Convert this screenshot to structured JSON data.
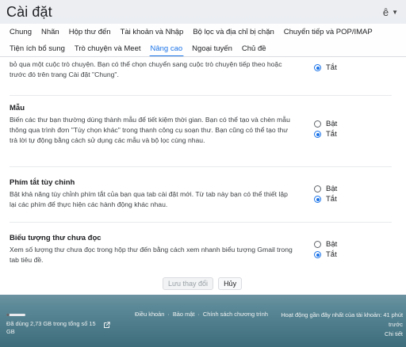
{
  "header": {
    "title": "Cài đặt",
    "lang": "ê"
  },
  "tabs": {
    "row1": [
      "Chung",
      "Nhãn",
      "Hộp thư đến",
      "Tài khoản và Nhập",
      "Bộ lọc và địa chỉ bị chặn",
      "Chuyển tiếp và POP/IMAP"
    ],
    "row2": [
      "Tiện ích bổ sung",
      "Trò chuyện và Meet",
      "Nâng cao",
      "Ngoại tuyến",
      "Chủ đề"
    ],
    "active": "Nâng cao"
  },
  "sections": {
    "partial": {
      "desc": "bỏ qua một cuộc trò chuyện. Bạn có thể chọn chuyển sang cuộc trò chuyện tiếp theo hoặc trước đó trên trang Cài đặt \"Chung\".",
      "off_label": "Tắt"
    },
    "templates": {
      "title": "Mẫu",
      "desc": "Biến các thư bạn thường dùng thành mẫu để tiết kiệm thời gian. Bạn có thể tạo và chèn mẫu thông qua trình đơn \"Tùy chọn khác\" trong thanh công cụ soạn thư. Bạn cũng có thể tạo thư trả lời tự động bằng cách sử dụng các mẫu và bộ lọc cùng nhau.",
      "on_label": "Bật",
      "off_label": "Tắt"
    },
    "shortcuts": {
      "title": "Phím tắt tùy chỉnh",
      "desc": "Bật khả năng tùy chỉnh phím tắt của bạn qua tab cài đặt mới. Từ tab này bạn có thể thiết lập lại các phím để thực hiện các hành động khác nhau.",
      "on_label": "Bật",
      "off_label": "Tắt"
    },
    "unread": {
      "title": "Biểu tượng thư chưa đọc",
      "desc": "Xem số lượng thư chưa đọc trong hộp thư đến bằng cách xem nhanh biểu tượng Gmail trong tab tiêu đề.",
      "on_label": "Bật",
      "off_label": "Tắt"
    }
  },
  "actions": {
    "save": "Lưu thay đổi",
    "cancel": "Hủy"
  },
  "footer": {
    "storage": "Đã dùng 2,73 GB trong tổng số 15 GB",
    "storage_fraction": 0.18,
    "links": [
      "Điều khoản",
      "·",
      "Bảo mật",
      "·",
      "Chính sách chương trình"
    ],
    "activity": "Hoạt động gần đây nhất của tài khoản: 41 phút trước",
    "details": "Chi tiết"
  }
}
